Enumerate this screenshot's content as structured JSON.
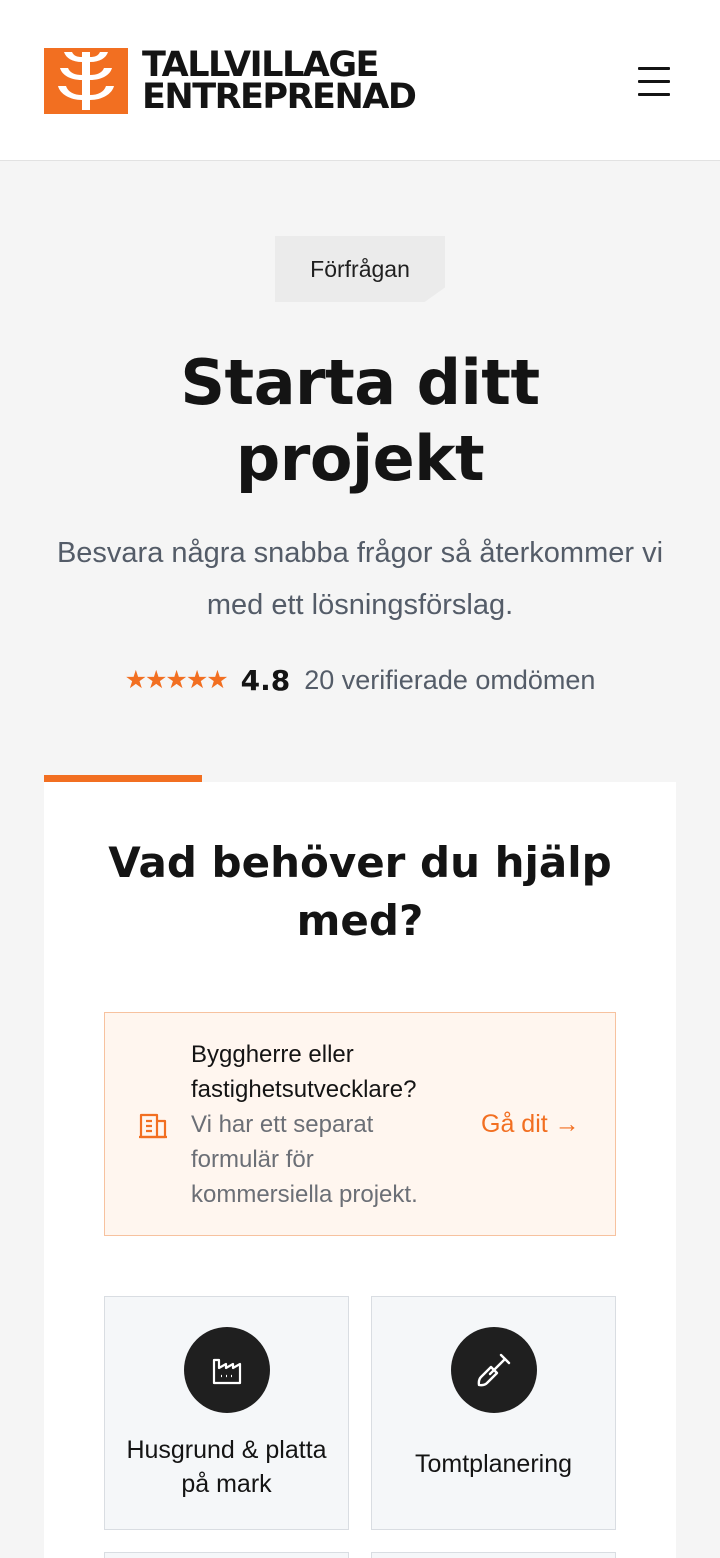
{
  "header": {
    "logo_line1": "TALLVILLAGE",
    "logo_line2": "ENTREPRENAD",
    "menu_icon": "hamburger-menu-icon"
  },
  "hero": {
    "chip": "Förfrågan",
    "title": "Starta ditt projekt",
    "subtitle": "Besvara några snabba frågor så återkommer vi med ett lösningsförslag.",
    "stars": "★★★★★",
    "rating": 4.8,
    "rating_text": "4.8",
    "reviews": "20 verifierade omdömen"
  },
  "form": {
    "progress_fraction": 0.25,
    "question": "Vad behöver du hjälp med?",
    "notice": {
      "icon": "building-icon",
      "title": "Byggherre eller fastighetsutvecklare?",
      "body": "Vi har ett separat formulär för kommersiella projekt.",
      "link": "Gå dit →"
    },
    "options": [
      {
        "label": "Husgrund & platta på mark",
        "icon": "factory-icon"
      },
      {
        "label": "Tomtplanering",
        "icon": "shovel-icon"
      }
    ]
  },
  "colors": {
    "accent": "#f26f21",
    "text": "#141414",
    "muted": "#545c68"
  }
}
